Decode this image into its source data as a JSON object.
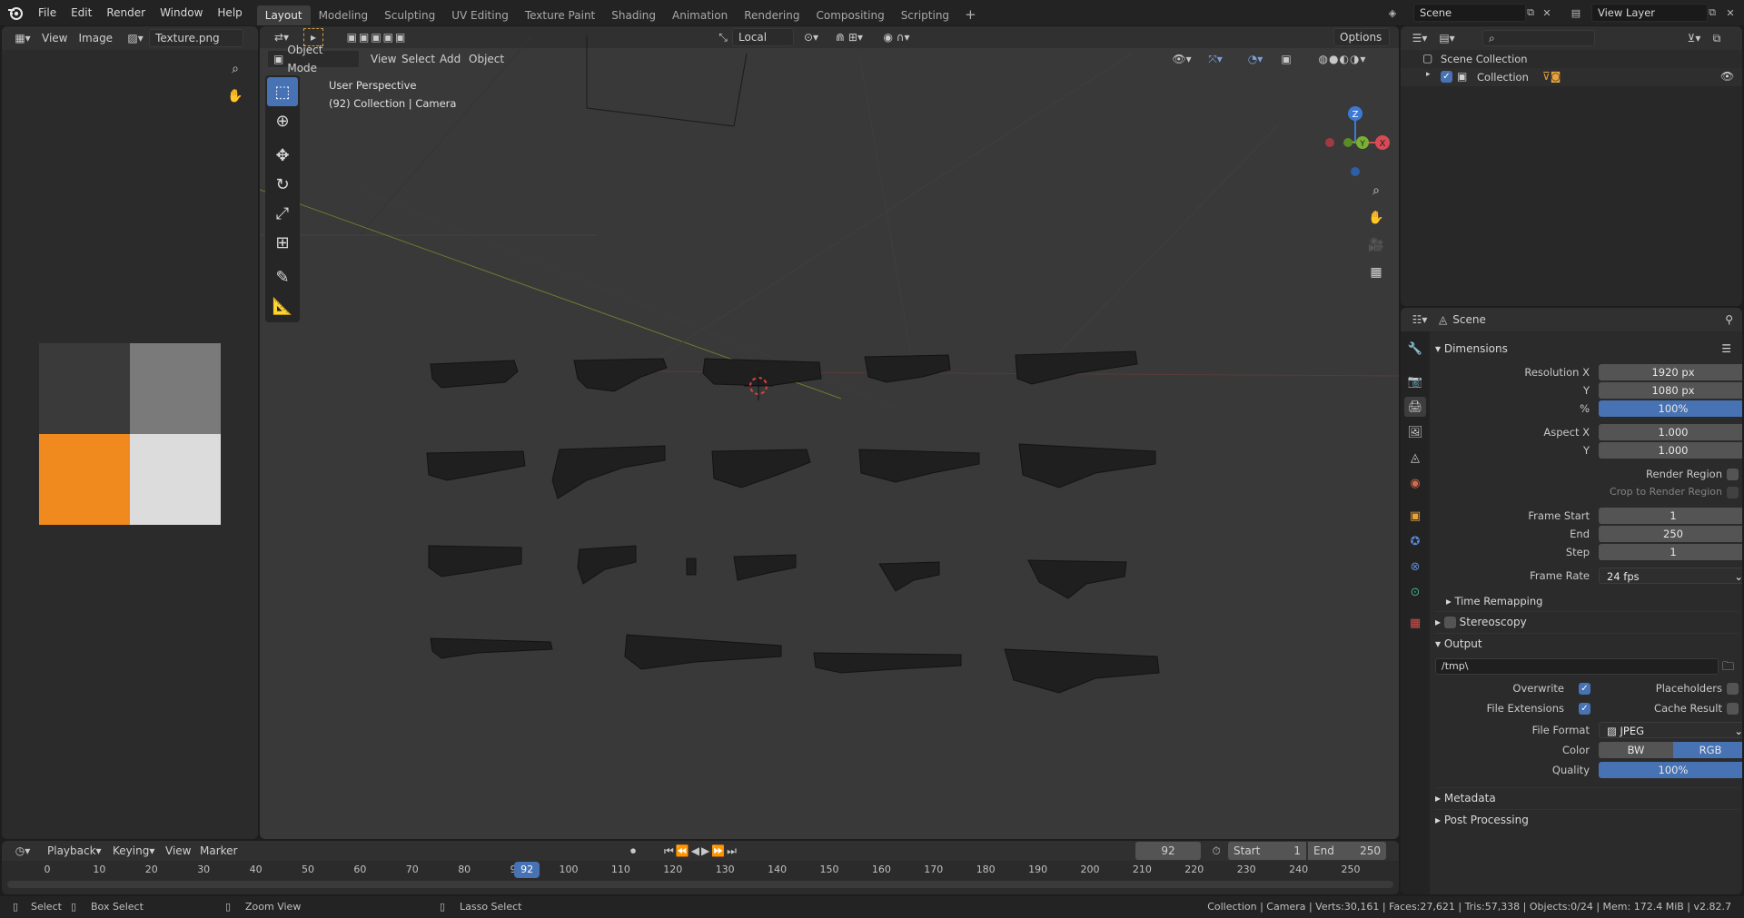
{
  "topbar": {
    "menus": [
      "File",
      "Edit",
      "Render",
      "Window",
      "Help"
    ],
    "workspaces": [
      "Layout",
      "Modeling",
      "Sculpting",
      "UV Editing",
      "Texture Paint",
      "Shading",
      "Animation",
      "Rendering",
      "Compositing",
      "Scripting"
    ],
    "active_workspace": "Layout",
    "scene_name": "Scene",
    "view_layer": "View Layer"
  },
  "image_editor": {
    "menus": [
      "View",
      "Image"
    ],
    "image_name": "Texture.png",
    "swatch_colors": [
      "#3a3a3a",
      "#7a7a7a",
      "#f08a1e",
      "#dcdcdc"
    ]
  },
  "viewport": {
    "mode": "Object Mode",
    "menus": [
      "View",
      "Select",
      "Add",
      "Object"
    ],
    "orientation": "Local",
    "options_label": "Options",
    "perspective_label": "User Perspective",
    "context_label": "(92) Collection | Camera",
    "gizmo": {
      "z": "Z",
      "y": "Y",
      "x": "X"
    }
  },
  "outliner": {
    "root": "Scene Collection",
    "collection": "Collection"
  },
  "properties": {
    "context": "Scene",
    "dimensions": {
      "title": "Dimensions",
      "resolution_x_label": "Resolution X",
      "resolution_x": "1920 px",
      "resolution_y_label": "Y",
      "resolution_y": "1080 px",
      "percent_label": "%",
      "percent": "100%",
      "aspect_x_label": "Aspect X",
      "aspect_x": "1.000",
      "aspect_y_label": "Y",
      "aspect_y": "1.000",
      "render_region": "Render Region",
      "crop_region": "Crop to Render Region",
      "frame_start_label": "Frame Start",
      "frame_start": "1",
      "end_label": "End",
      "end": "250",
      "step_label": "Step",
      "step": "1",
      "frame_rate_label": "Frame Rate",
      "frame_rate": "24 fps",
      "time_remapping": "Time Remapping"
    },
    "stereoscopy": "Stereoscopy",
    "output": {
      "title": "Output",
      "path": "/tmp\\",
      "overwrite": "Overwrite",
      "placeholders": "Placeholders",
      "file_extensions": "File Extensions",
      "cache_result": "Cache Result",
      "file_format_label": "File Format",
      "file_format": "JPEG",
      "color_label": "Color",
      "color_bw": "BW",
      "color_rgb": "RGB",
      "quality_label": "Quality",
      "quality": "100%"
    },
    "metadata": "Metadata",
    "post_processing": "Post Processing"
  },
  "timeline": {
    "menus": [
      "Playback",
      "Keying",
      "View",
      "Marker"
    ],
    "current_frame": "92",
    "start_label": "Start",
    "start": "1",
    "end_label": "End",
    "end": "250",
    "ticks": [
      "0",
      "10",
      "20",
      "30",
      "40",
      "50",
      "60",
      "70",
      "80",
      "90",
      "100",
      "110",
      "120",
      "130",
      "140",
      "150",
      "160",
      "170",
      "180",
      "190",
      "200",
      "210",
      "220",
      "230",
      "240",
      "250"
    ],
    "playhead_frame": 92
  },
  "statusbar": {
    "select": "Select",
    "box_select": "Box Select",
    "zoom_view": "Zoom View",
    "lasso_select": "Lasso Select",
    "stats": "Collection | Camera | Verts:30,161 | Faces:27,621 | Tris:57,338 | Objects:0/24 | Mem: 172.4 MiB | v2.82.7"
  },
  "colors": {
    "accent": "#4772b3",
    "orange": "#f08a1e"
  }
}
